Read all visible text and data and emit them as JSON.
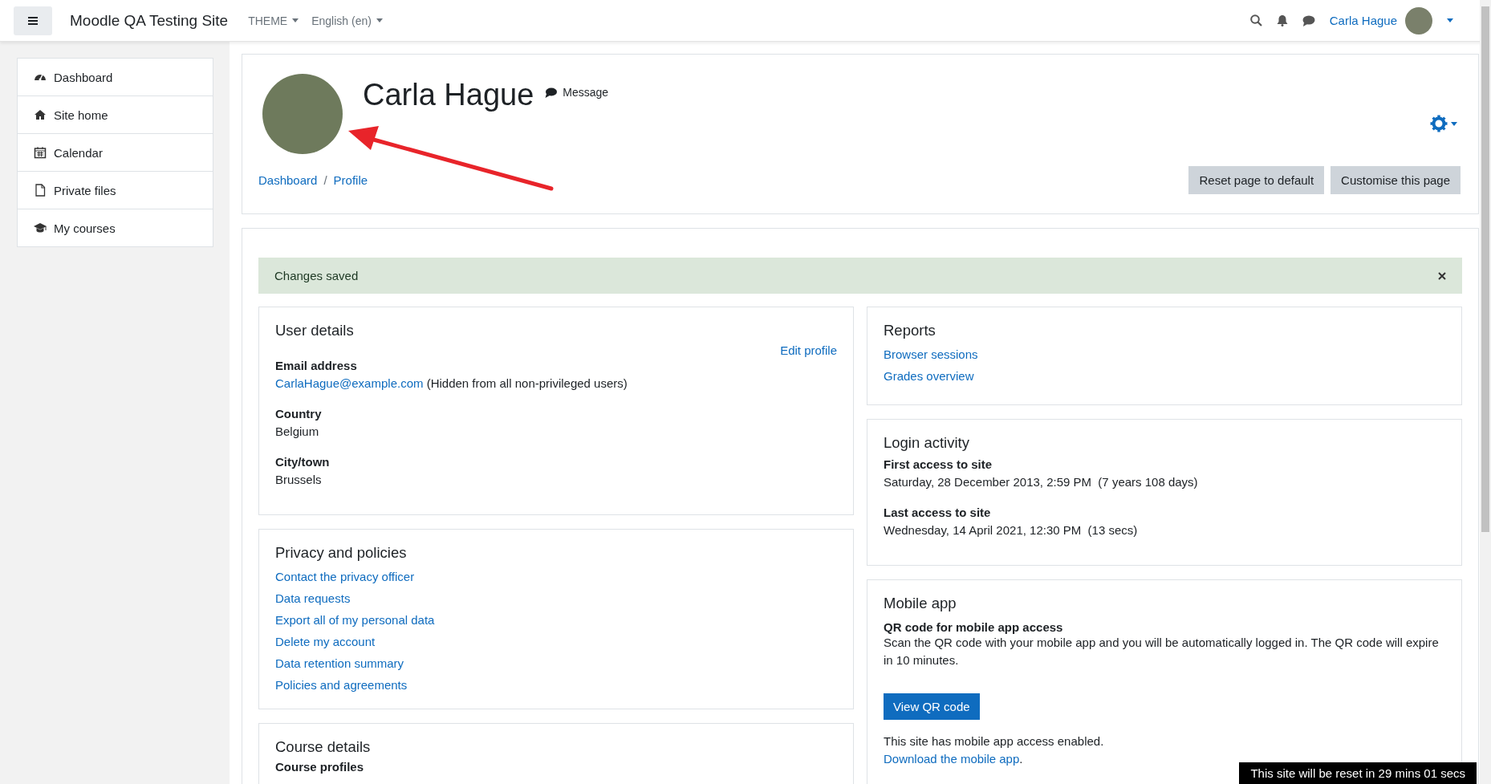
{
  "navbar": {
    "site_name": "Moodle QA Testing Site",
    "menus": [
      {
        "label": "THEME"
      },
      {
        "label": "English (en)"
      }
    ],
    "user_name": "Carla Hague"
  },
  "sidebar": {
    "items": [
      {
        "label": "Dashboard"
      },
      {
        "label": "Site home"
      },
      {
        "label": "Calendar"
      },
      {
        "label": "Private files"
      },
      {
        "label": "My courses"
      }
    ]
  },
  "header": {
    "name": "Carla Hague",
    "message": "Message",
    "breadcrumb": [
      "Dashboard",
      "Profile"
    ],
    "breadcrumb_separator": "/",
    "buttons": [
      "Reset page to default",
      "Customise this page"
    ]
  },
  "alert": {
    "text": "Changes saved"
  },
  "user_details": {
    "title": "User details",
    "edit_link": "Edit profile",
    "fields": [
      {
        "label": "Email address",
        "link": "CarlaHague@example.com",
        "value": "(Hidden from all non-privileged users)"
      },
      {
        "label": "Country",
        "value": "Belgium"
      },
      {
        "label": "City/town",
        "value": "Brussels"
      }
    ]
  },
  "privacy": {
    "title": "Privacy and policies",
    "links": [
      "Contact the privacy officer",
      "Data requests",
      "Export all of my personal data",
      "Delete my account",
      "Data retention summary",
      "Policies and agreements"
    ]
  },
  "course_details": {
    "title": "Course details",
    "fields": [
      {
        "label": "Course profiles"
      }
    ]
  },
  "reports": {
    "title": "Reports",
    "links": [
      "Browser sessions",
      "Grades overview"
    ]
  },
  "login_activity": {
    "title": "Login activity",
    "fields": [
      {
        "label": "First access to site",
        "value": "Saturday, 28 December 2013, 2:59 PM",
        "duration": "(7 years 108 days)"
      },
      {
        "label": "Last access to site",
        "value": "Wednesday, 14 April 2021, 12:30 PM",
        "duration": "(13 secs)"
      }
    ]
  },
  "mobile_app": {
    "title": "Mobile app",
    "subtitle": "QR code for mobile app access",
    "text": "Scan the QR code with your mobile app and you will be automatically logged in. The QR code will expire in 10 minutes.",
    "button": "View QR code",
    "note": "This site has mobile app access enabled.",
    "link": "Download the mobile app",
    "link_suffix": "."
  },
  "timer": {
    "text": "This site will be reset in 29 mins 01 secs"
  }
}
